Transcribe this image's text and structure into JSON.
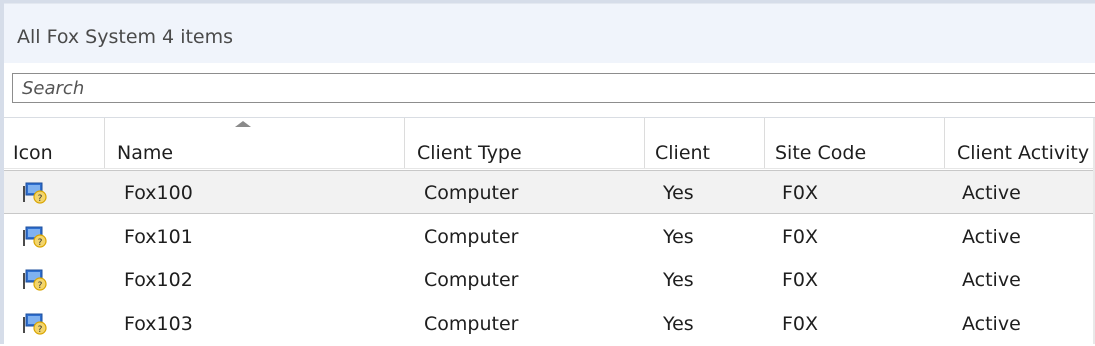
{
  "view": {
    "title": "All Fox System 4 items"
  },
  "search": {
    "placeholder": "Search",
    "value": ""
  },
  "columns": [
    {
      "key": "icon",
      "label": "Icon"
    },
    {
      "key": "name",
      "label": "Name",
      "sorted": "ascending"
    },
    {
      "key": "client_type",
      "label": "Client Type"
    },
    {
      "key": "client",
      "label": "Client"
    },
    {
      "key": "site_code",
      "label": "Site Code"
    },
    {
      "key": "client_activity",
      "label": "Client Activity"
    }
  ],
  "rows": [
    {
      "icon": "computer-unknown-icon",
      "name": "Fox100",
      "client_type": "Computer",
      "client": "Yes",
      "site_code": "F0X",
      "client_activity": "Active",
      "selected": true
    },
    {
      "icon": "computer-unknown-icon",
      "name": "Fox101",
      "client_type": "Computer",
      "client": "Yes",
      "site_code": "F0X",
      "client_activity": "Active",
      "selected": false
    },
    {
      "icon": "computer-unknown-icon",
      "name": "Fox102",
      "client_type": "Computer",
      "client": "Yes",
      "site_code": "F0X",
      "client_activity": "Active",
      "selected": false
    },
    {
      "icon": "computer-unknown-icon",
      "name": "Fox103",
      "client_type": "Computer",
      "client": "Yes",
      "site_code": "F0X",
      "client_activity": "Active",
      "selected": false
    }
  ],
  "colors": {
    "header_strip": "#f0f4fb",
    "selected_row": "#f2f2f2",
    "icon_blue": "#2f6fd0",
    "icon_gold": "#d9a400"
  }
}
